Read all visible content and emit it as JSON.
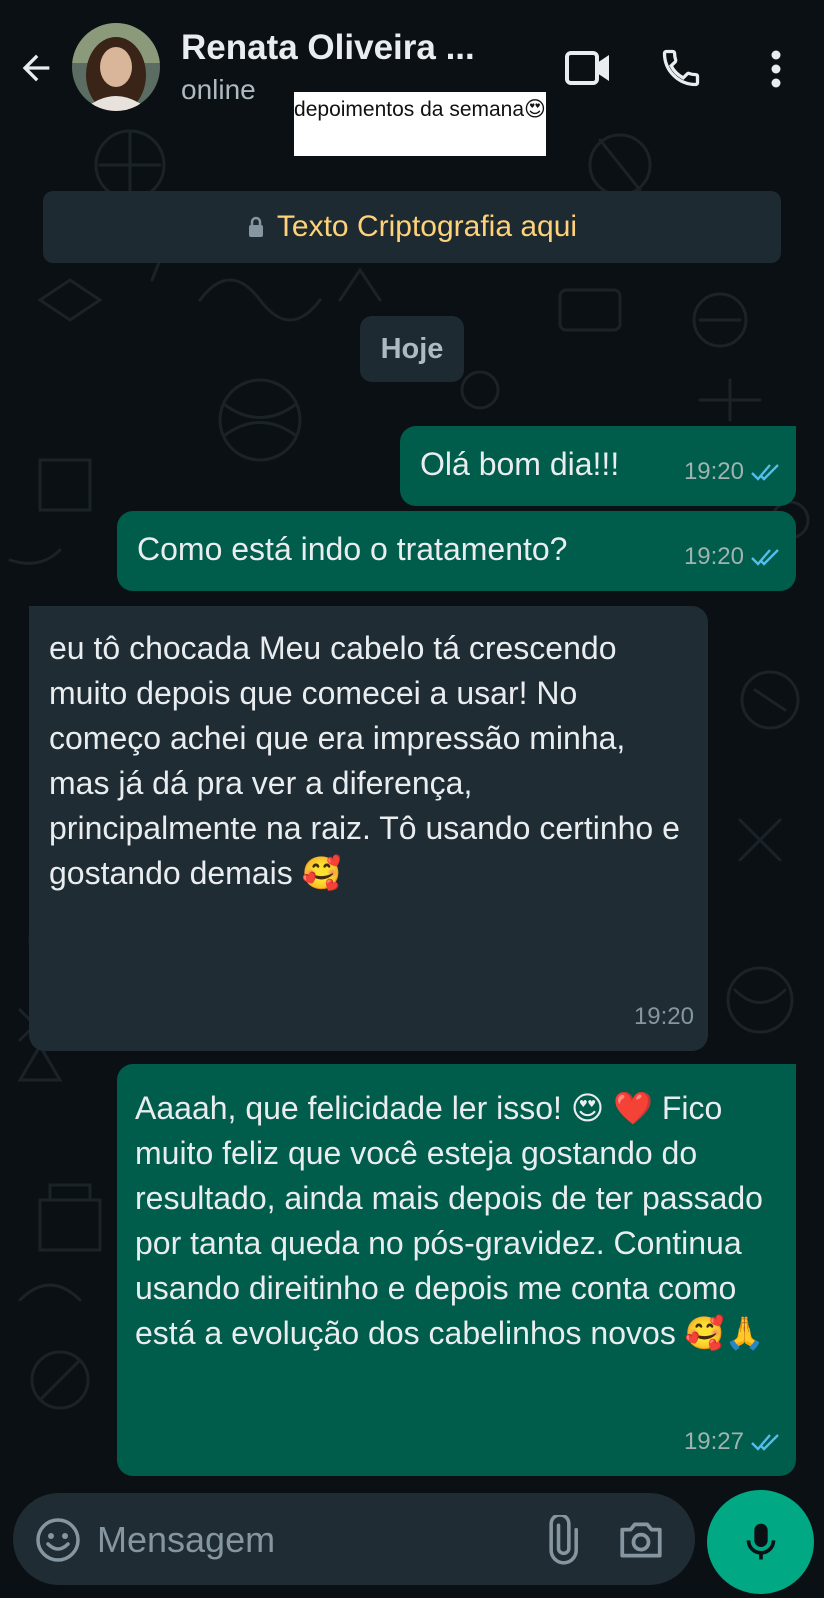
{
  "header": {
    "contact_name": "Renata Oliveira ...",
    "status": "online"
  },
  "story_label": "depoimentos da semana😍",
  "encryption_notice": "Texto Criptografia aqui",
  "date_chip": "Hoje",
  "messages": [
    {
      "direction": "outgoing",
      "text": "Olá bom dia!!!",
      "time": "19:20",
      "status": "read"
    },
    {
      "direction": "outgoing",
      "text": "Como está indo o tratamento?",
      "time": "19:20",
      "status": "read"
    },
    {
      "direction": "incoming",
      "text": "eu tô chocada  Meu cabelo tá crescendo muito depois que comecei a usar! No começo achei que era impressão minha, mas já dá pra ver a diferença, principalmente na raiz. Tô usando certinho e gostando demais 🥰",
      "time": "19:20"
    },
    {
      "direction": "outgoing",
      "text": "Aaaah, que felicidade ler isso! 😍 ❤️ Fico muito feliz que você esteja gostando do resultado, ainda mais depois de ter passado por tanta queda no pós-gravidez. Continua usando direitinho e depois me conta como está a evolução dos cabelinhos novos 🥰🙏",
      "time": "19:27",
      "status": "read"
    }
  ],
  "input": {
    "placeholder": "Mensagem"
  },
  "icons": {
    "back": "arrow-left-icon",
    "video": "video-camera-icon",
    "call": "phone-icon",
    "menu": "kebab-menu-icon",
    "lock": "lock-icon",
    "emoji": "emoji-icon",
    "attach": "paperclip-icon",
    "camera": "camera-icon",
    "mic": "microphone-icon",
    "read": "double-check-icon"
  },
  "colors": {
    "background": "#0b1014",
    "outgoing_bubble": "#005c4b",
    "incoming_bubble": "#1f2c33",
    "encryption_text": "#ffd279",
    "read_ticks": "#53bdeb",
    "accent": "#00a884"
  }
}
